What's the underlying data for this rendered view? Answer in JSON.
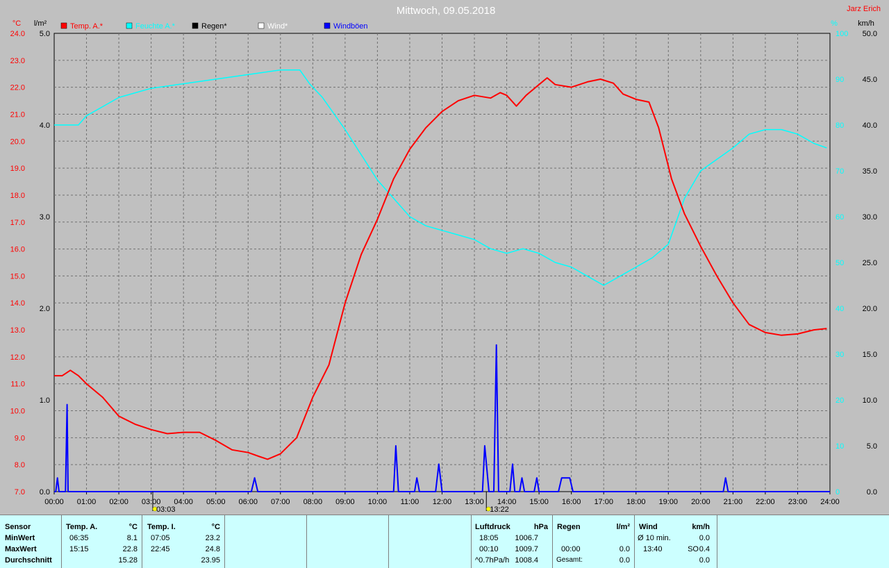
{
  "chart_data": {
    "type": "line",
    "title": "Mittwoch, 09.05.2018",
    "author": "Jarz Erich",
    "x_ticks": [
      "00:00",
      "01:00",
      "02:00",
      "03:00",
      "04:00",
      "05:00",
      "06:00",
      "07:00",
      "08:00",
      "09:00",
      "10:00",
      "11:00",
      "12:00",
      "13:00",
      "14:00",
      "15:00",
      "16:00",
      "17:00",
      "18:00",
      "19:00",
      "20:00",
      "21:00",
      "22:00",
      "23:00",
      "24:00"
    ],
    "xlim": [
      0,
      24
    ],
    "left_axis_1": {
      "unit": "°C",
      "range": [
        7.0,
        24.0
      ],
      "ticks": [
        "7.0",
        "8.0",
        "9.0",
        "10.0",
        "11.0",
        "12.0",
        "13.0",
        "14.0",
        "15.0",
        "16.0",
        "17.0",
        "18.0",
        "19.0",
        "20.0",
        "21.0",
        "22.0",
        "23.0",
        "24.0"
      ],
      "color": "#ff0000"
    },
    "left_axis_2": {
      "unit": "l/m²",
      "range": [
        0.0,
        5.0
      ],
      "ticks": [
        "0.0",
        "1.0",
        "2.0",
        "3.0",
        "4.0",
        "5.0"
      ]
    },
    "right_axis_1": {
      "unit": "%",
      "range": [
        0,
        100
      ],
      "ticks": [
        "0",
        "10",
        "20",
        "30",
        "40",
        "50",
        "60",
        "70",
        "80",
        "90",
        "100"
      ],
      "color": "#00ffff"
    },
    "right_axis_2": {
      "unit": "km/h",
      "range": [
        0.0,
        50.0
      ],
      "ticks": [
        "0.0",
        "5.0",
        "10.0",
        "15.0",
        "20.0",
        "25.0",
        "30.0",
        "35.0",
        "40.0",
        "45.0",
        "50.0"
      ]
    },
    "legend": [
      {
        "label": "Temp. A.*",
        "color": "#ff0000"
      },
      {
        "label": "Feuchte A.*",
        "color": "#00ffff"
      },
      {
        "label": "Regen*",
        "color": "#000000"
      },
      {
        "label": "Wind*",
        "color": "#ffffff"
      },
      {
        "label": "Windböen",
        "color": "#0000ff"
      }
    ],
    "markers": [
      {
        "time": 3.05,
        "label": "03:03"
      },
      {
        "time": 13.37,
        "label": "13:22"
      }
    ],
    "series": [
      {
        "name": "Temp. A.*",
        "color": "#ff0000",
        "unit": "°C",
        "points": [
          [
            0,
            11.3
          ],
          [
            0.25,
            11.3
          ],
          [
            0.5,
            11.5
          ],
          [
            0.75,
            11.3
          ],
          [
            1,
            11.0
          ],
          [
            1.5,
            10.5
          ],
          [
            2,
            9.8
          ],
          [
            2.5,
            9.5
          ],
          [
            3,
            9.3
          ],
          [
            3.5,
            9.15
          ],
          [
            4,
            9.2
          ],
          [
            4.5,
            9.2
          ],
          [
            5,
            8.9
          ],
          [
            5.5,
            8.55
          ],
          [
            6,
            8.45
          ],
          [
            6.35,
            8.3
          ],
          [
            6.6,
            8.2
          ],
          [
            7,
            8.4
          ],
          [
            7.5,
            9.0
          ],
          [
            8,
            10.5
          ],
          [
            8.5,
            11.7
          ],
          [
            9,
            14.0
          ],
          [
            9.5,
            15.8
          ],
          [
            10,
            17.1
          ],
          [
            10.5,
            18.6
          ],
          [
            11,
            19.7
          ],
          [
            11.5,
            20.5
          ],
          [
            12,
            21.1
          ],
          [
            12.5,
            21.5
          ],
          [
            13,
            21.7
          ],
          [
            13.5,
            21.6
          ],
          [
            13.8,
            21.8
          ],
          [
            14,
            21.7
          ],
          [
            14.3,
            21.3
          ],
          [
            14.6,
            21.7
          ],
          [
            15,
            22.1
          ],
          [
            15.25,
            22.35
          ],
          [
            15.5,
            22.1
          ],
          [
            16,
            22.0
          ],
          [
            16.5,
            22.2
          ],
          [
            16.9,
            22.3
          ],
          [
            17.3,
            22.15
          ],
          [
            17.6,
            21.75
          ],
          [
            18,
            21.55
          ],
          [
            18.4,
            21.45
          ],
          [
            18.7,
            20.5
          ],
          [
            19.1,
            18.6
          ],
          [
            19.5,
            17.3
          ],
          [
            20,
            16.1
          ],
          [
            20.5,
            15.0
          ],
          [
            21,
            14.0
          ],
          [
            21.5,
            13.2
          ],
          [
            22,
            12.9
          ],
          [
            22.5,
            12.8
          ],
          [
            23,
            12.85
          ],
          [
            23.5,
            13.0
          ],
          [
            23.9,
            13.05
          ]
        ]
      },
      {
        "name": "Feuchte A.*",
        "color": "#00ffff",
        "unit": "%",
        "points": [
          [
            0,
            80
          ],
          [
            0.5,
            80
          ],
          [
            0.75,
            80
          ],
          [
            1,
            82
          ],
          [
            1.5,
            84
          ],
          [
            2,
            86
          ],
          [
            3,
            88
          ],
          [
            4,
            89
          ],
          [
            5,
            90
          ],
          [
            6,
            91
          ],
          [
            7,
            92
          ],
          [
            7.6,
            92
          ],
          [
            7.9,
            89
          ],
          [
            8.3,
            86
          ],
          [
            9,
            79
          ],
          [
            10,
            68
          ],
          [
            10.5,
            64
          ],
          [
            11,
            60
          ],
          [
            11.5,
            58
          ],
          [
            12,
            57
          ],
          [
            12.5,
            56
          ],
          [
            13,
            55
          ],
          [
            13.5,
            53
          ],
          [
            14,
            52
          ],
          [
            14.5,
            53
          ],
          [
            15,
            52
          ],
          [
            15.5,
            50
          ],
          [
            16,
            49
          ],
          [
            16.5,
            47
          ],
          [
            17,
            45
          ],
          [
            17.5,
            47
          ],
          [
            18,
            49
          ],
          [
            18.5,
            51
          ],
          [
            19,
            54
          ],
          [
            19.5,
            64
          ],
          [
            20,
            70
          ],
          [
            21,
            75
          ],
          [
            21.5,
            78
          ],
          [
            22,
            79
          ],
          [
            22.5,
            79
          ],
          [
            23,
            78
          ],
          [
            23.5,
            76
          ],
          [
            23.9,
            75
          ]
        ]
      },
      {
        "name": "Windböen",
        "color": "#0000ff",
        "unit": "km/h",
        "points": [
          [
            0,
            0
          ],
          [
            0.05,
            0
          ],
          [
            0.1,
            1.5
          ],
          [
            0.15,
            0
          ],
          [
            0.35,
            0
          ],
          [
            0.4,
            9.5
          ],
          [
            0.43,
            0
          ],
          [
            6.1,
            0
          ],
          [
            6.2,
            1.5
          ],
          [
            6.3,
            0
          ],
          [
            10.5,
            0
          ],
          [
            10.57,
            5.0
          ],
          [
            10.65,
            0
          ],
          [
            11.15,
            0
          ],
          [
            11.22,
            1.5
          ],
          [
            11.3,
            0
          ],
          [
            11.8,
            0
          ],
          [
            11.9,
            3.0
          ],
          [
            12.0,
            0
          ],
          [
            13.25,
            0
          ],
          [
            13.32,
            5.0
          ],
          [
            13.45,
            0
          ],
          [
            13.6,
            0
          ],
          [
            13.68,
            16.0
          ],
          [
            13.75,
            0
          ],
          [
            14.1,
            0
          ],
          [
            14.18,
            3.0
          ],
          [
            14.25,
            0
          ],
          [
            14.4,
            0
          ],
          [
            14.47,
            1.5
          ],
          [
            14.55,
            0
          ],
          [
            14.85,
            0
          ],
          [
            14.93,
            1.5
          ],
          [
            15.0,
            0
          ],
          [
            15.6,
            0
          ],
          [
            15.7,
            1.5
          ],
          [
            15.95,
            1.5
          ],
          [
            16.05,
            0
          ],
          [
            20.7,
            0
          ],
          [
            20.77,
            1.5
          ],
          [
            20.85,
            0
          ],
          [
            24,
            0
          ]
        ]
      }
    ]
  },
  "table": {
    "sensor": {
      "title": "Sensor",
      "rows": [
        "MinWert",
        "MaxWert",
        "Durchschnitt"
      ]
    },
    "temp_a": {
      "title": "Temp. A.",
      "unit": "°C",
      "rows": [
        [
          "06:35",
          "8.1"
        ],
        [
          "15:15",
          "22.8"
        ],
        [
          "",
          "15.28"
        ]
      ]
    },
    "temp_i": {
      "title": "Temp. I.",
      "unit": "°C",
      "rows": [
        [
          "07:05",
          "23.2"
        ],
        [
          "22:45",
          "24.8"
        ],
        [
          "",
          "23.95"
        ]
      ]
    },
    "luftdruck": {
      "title": "Luftdruck",
      "unit": "hPa",
      "rows": [
        [
          "18:05",
          "1006.7"
        ],
        [
          "00:10",
          "1009.7"
        ],
        [
          "^0.7hPa/h",
          "1008.4"
        ]
      ]
    },
    "regen": {
      "title": "Regen",
      "unit": "l/m²",
      "rows": [
        [
          "",
          ""
        ],
        [
          "00:00",
          "0.0"
        ],
        [
          "Gesamt:",
          "0.0"
        ]
      ]
    },
    "wind": {
      "title": "Wind",
      "unit": "km/h",
      "rows": [
        [
          "Ø 10 min.",
          "",
          "0.0"
        ],
        [
          "13:40",
          "SO",
          "0.4"
        ],
        [
          "",
          "",
          "0.0"
        ]
      ]
    }
  }
}
